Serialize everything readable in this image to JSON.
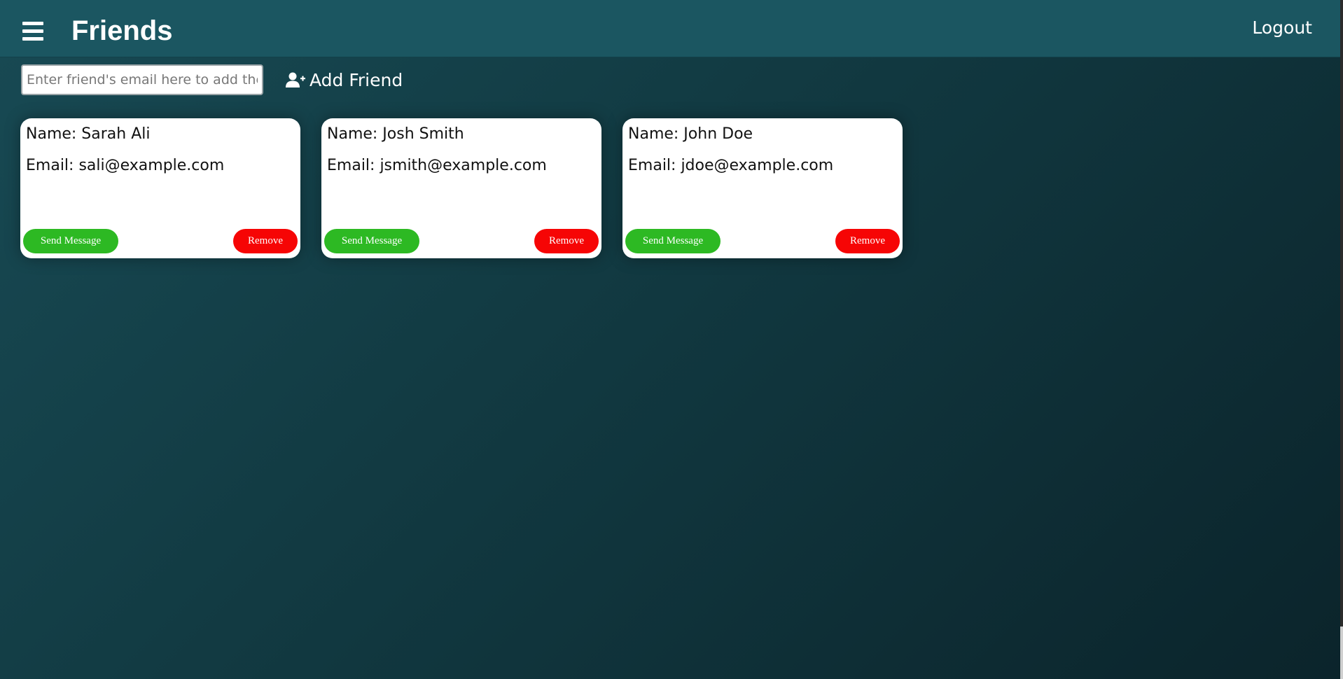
{
  "header": {
    "title": "Friends",
    "logout_label": "Logout",
    "menu_icon": "hamburger-menu-icon"
  },
  "add_friend": {
    "placeholder": "Enter friend's email here to add them",
    "value": "",
    "button_label": "Add Friend",
    "button_icon": "user-plus-icon"
  },
  "friends": [
    {
      "name_label": "Name: Sarah Ali",
      "email_label": "Email: sali@example.com",
      "send_label": "Send Message",
      "remove_label": "Remove"
    },
    {
      "name_label": "Name: Josh Smith",
      "email_label": "Email: jsmith@example.com",
      "send_label": "Send Message",
      "remove_label": "Remove"
    },
    {
      "name_label": "Name: John Doe",
      "email_label": "Email: jdoe@example.com",
      "send_label": "Send Message",
      "remove_label": "Remove"
    }
  ],
  "colors": {
    "header_bg": "#1b5661",
    "send_button": "#2db923",
    "remove_button": "#f60505",
    "card_bg": "#ffffff"
  }
}
